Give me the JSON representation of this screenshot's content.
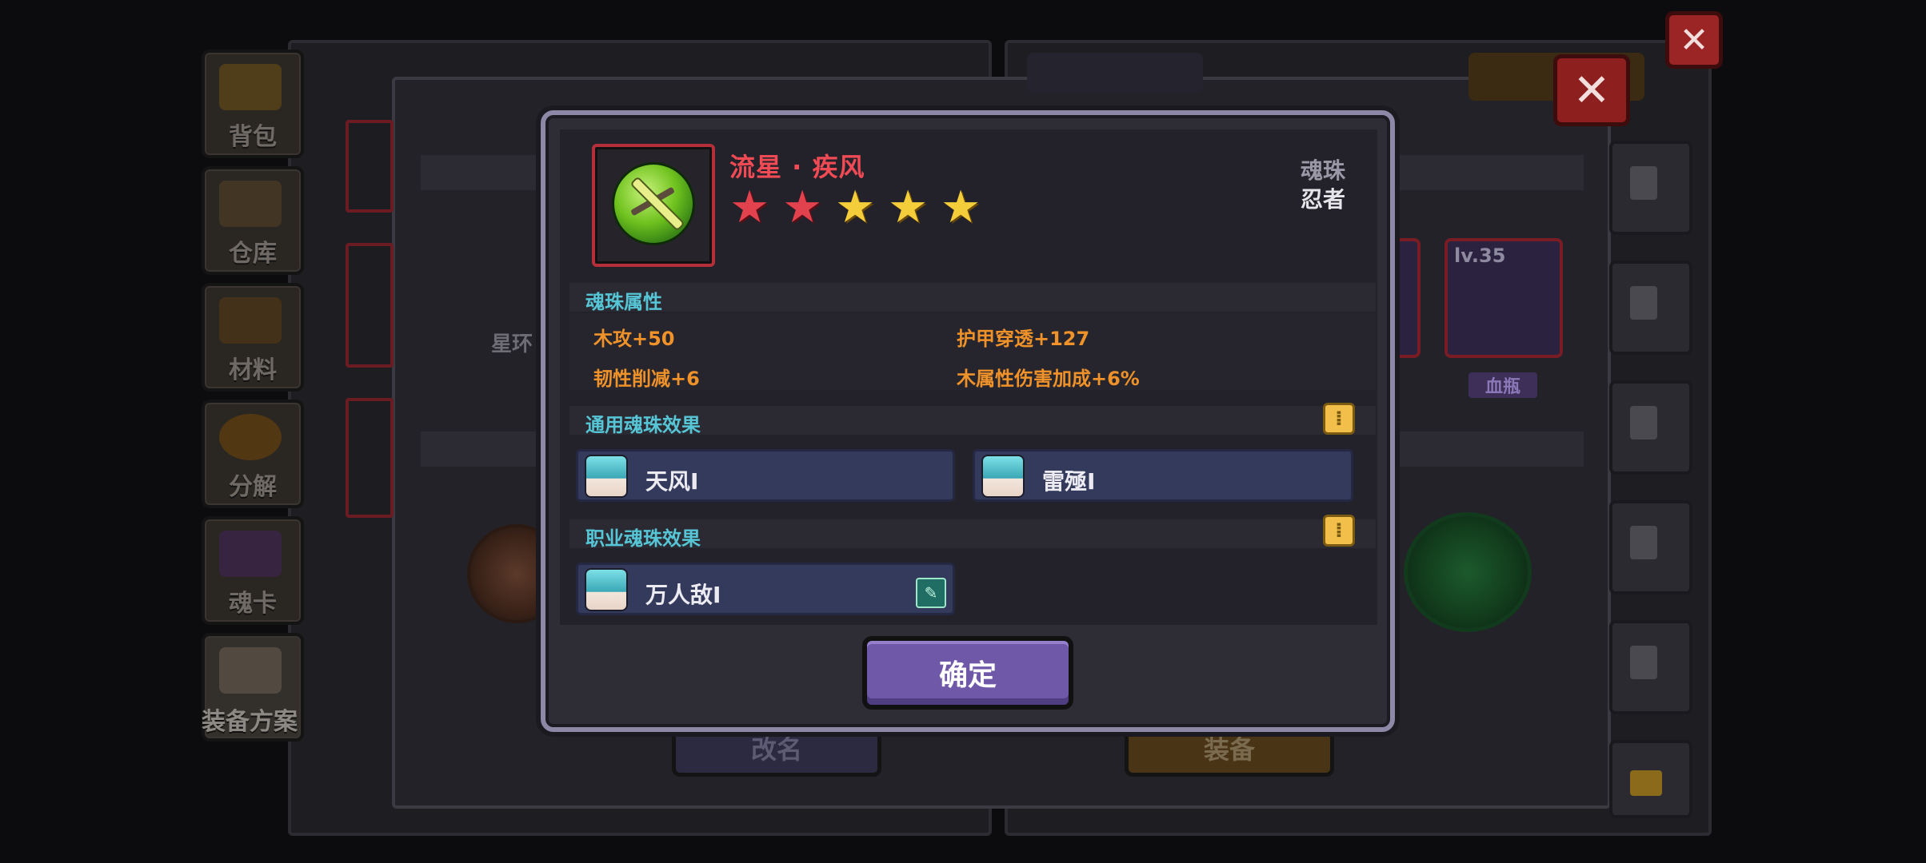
{
  "sidebar": {
    "items": [
      {
        "label": "背包",
        "icon": "chest-icon"
      },
      {
        "label": "仓库",
        "icon": "warehouse-icon"
      },
      {
        "label": "材料",
        "icon": "material-icon"
      },
      {
        "label": "分解",
        "icon": "decompose-icon"
      },
      {
        "label": "魂卡",
        "icon": "soul-card-icon"
      },
      {
        "label": "装备方案",
        "icon": "equipment-plan-icon"
      }
    ]
  },
  "background": {
    "left_label": "星环",
    "rename_button": "改名",
    "equip_button": "装备",
    "item_level": "lv.35",
    "item_tag": "血瓶"
  },
  "dialog": {
    "item_name": "流星 · 疾风",
    "stars": {
      "red": 2,
      "gold": 3,
      "total": 5
    },
    "item_type": "魂珠",
    "item_class": "忍者",
    "attributes": {
      "title": "魂珠属性",
      "list": [
        "木攻+50",
        "护甲穿透+127",
        "韧性削减+6",
        "木属性伤害加成+6%"
      ]
    },
    "general_effects": {
      "title": "通用魂珠效果",
      "items": [
        "天风Ⅰ",
        "雷殛Ⅰ"
      ]
    },
    "class_effects": {
      "title": "职业魂珠效果",
      "items": [
        "万人敌Ⅰ"
      ]
    },
    "confirm_label": "确定"
  },
  "colors": {
    "item_name": "#f04a55",
    "section_title": "#56c6d6",
    "attribute": "#f0922a",
    "confirm_button": "#6f58a8",
    "rarity_frame": "#b52f3a"
  }
}
